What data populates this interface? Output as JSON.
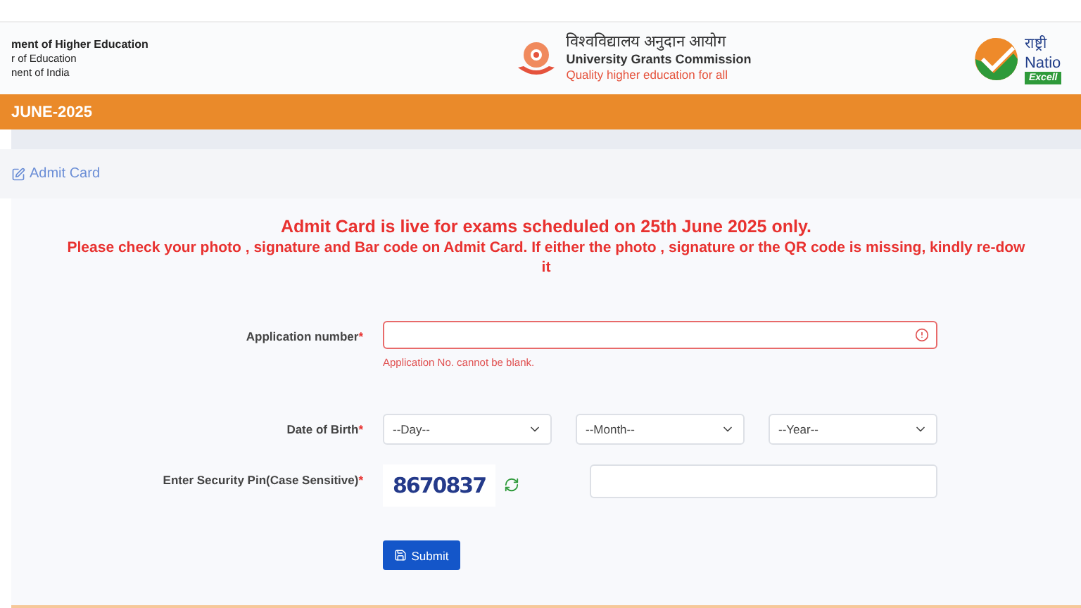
{
  "header": {
    "ministry": [
      "ment of Higher Education",
      "r of Education",
      "nent of India"
    ],
    "ugc": {
      "hindi": "विश्वविद्यालय अनुदान आयोग",
      "name": "University Grants Commission",
      "tagline": "Quality higher education for all"
    },
    "nta": {
      "hindi": "राष्ट्री",
      "name": "Natio",
      "badge": "Excell"
    }
  },
  "banner": {
    "title": "JUNE-2025"
  },
  "breadcrumb": {
    "label": "Admit Card"
  },
  "notice": {
    "headline": "Admit Card is live for exams scheduled on 25th June 2025 only.",
    "lines": [
      "Please check your photo , signature and Bar code on Admit Card. If either the photo , signature or the QR code is missing, kindly re-dow",
      "it"
    ]
  },
  "form": {
    "required_mark": "*",
    "application": {
      "label": "Application number",
      "required": true,
      "invalid": true,
      "error": "Application No. cannot be blank."
    },
    "dob": {
      "label": "Date of Birth",
      "required": true,
      "selects": [
        {
          "placeholder": "--Day--"
        },
        {
          "placeholder": "--Month--"
        },
        {
          "placeholder": "--Year--"
        }
      ]
    },
    "pin": {
      "label": "Enter Security Pin(Case Sensitive)",
      "required": true,
      "captcha": "8670837"
    },
    "submit": "Submit"
  }
}
